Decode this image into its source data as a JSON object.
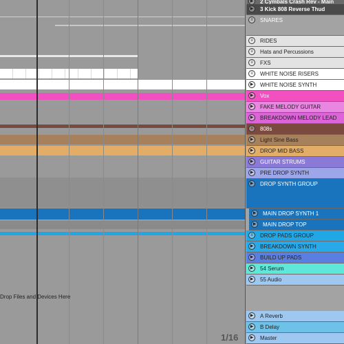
{
  "arrangement": {
    "drop_hint": "Drop Files and Devices Here",
    "zoom_label": "1/16"
  },
  "tracks": [
    {
      "label": "2 Cymbals Crash Rev - Main",
      "icon": "play-icon",
      "color": "#6a6a6a",
      "text_color": "#ffffff",
      "bold": true
    },
    {
      "label": "3 Kick 808 Reverse Thud",
      "icon": "play-icon",
      "color": "#4a4a4a",
      "text_color": "#ffffff",
      "bold": true
    },
    {
      "label": "SNARES",
      "icon": "group-icon",
      "color": "#a3a3a3",
      "text_color": "#ffffff",
      "bold": false
    },
    {
      "label": "RIDES",
      "icon": "group-icon",
      "color": "#e3e3e3",
      "text_color": "#222222",
      "bold": false
    },
    {
      "label": "Hats and Percussions",
      "icon": "group-icon",
      "color": "#e3e3e3",
      "text_color": "#222222",
      "bold": false
    },
    {
      "label": "FXS",
      "icon": "group-icon",
      "color": "#e3e3e3",
      "text_color": "#222222",
      "bold": false
    },
    {
      "label": "WHITE NOISE RISERS",
      "icon": "group-icon",
      "color": "#ffffff",
      "text_color": "#222222",
      "bold": false
    },
    {
      "label": "WHITE NOISE SYNTH",
      "icon": "play-icon",
      "color": "#ffffff",
      "text_color": "#222222",
      "bold": false
    },
    {
      "label": "Vox",
      "icon": "play-icon",
      "color": "#f24fc0",
      "text_color": "#ffffff",
      "bold": false
    },
    {
      "label": "FAKE MELODY GUITAR",
      "icon": "play-icon",
      "color": "#e986e1",
      "text_color": "#222222",
      "bold": false
    },
    {
      "label": "BREAKDOWN MELODY LEAD",
      "icon": "play-icon",
      "color": "#dc63d8",
      "text_color": "#222222",
      "bold": false
    },
    {
      "label": "808s",
      "icon": "group-icon",
      "color": "#7a4a3e",
      "text_color": "#ffffff",
      "bold": false
    },
    {
      "label": "Light Sine Bass",
      "icon": "play-icon",
      "color": "#a7815c",
      "text_color": "#222222",
      "bold": false
    },
    {
      "label": "DROP MID BASS",
      "icon": "play-icon",
      "color": "#e2ad66",
      "text_color": "#222222",
      "bold": false
    },
    {
      "label": "GUITAR STRUMS",
      "icon": "play-icon",
      "color": "#8b79d8",
      "text_color": "#ffffff",
      "bold": false
    },
    {
      "label": "PRE DROP SYNTH",
      "icon": "play-icon",
      "color": "#9ea6ea",
      "text_color": "#222222",
      "bold": false
    },
    {
      "label": "DROP SYNTH GROUP",
      "icon": "play-icon",
      "color": "#1a74bd",
      "text_color": "#ffffff",
      "bold": false
    },
    {
      "label": "MAIN DROP SYNTH 1",
      "icon": "play-icon",
      "color": "#1a74bd",
      "text_color": "#ffffff",
      "bold": false
    },
    {
      "label": "MAIN DROP TOP",
      "icon": "play-icon",
      "color": "#1a74bd",
      "text_color": "#ffffff",
      "bold": false
    },
    {
      "label": "DROP PADS GROUP",
      "icon": "group-icon",
      "color": "#22a7e6",
      "text_color": "#222222",
      "bold": false
    },
    {
      "label": "BREAKDOWN SYNTH",
      "icon": "play-icon",
      "color": "#28a9e9",
      "text_color": "#222222",
      "bold": false
    },
    {
      "label": "BUILD UP PADS",
      "icon": "play-icon",
      "color": "#5b7fe0",
      "text_color": "#222222",
      "bold": false
    },
    {
      "label": "54 Serum",
      "icon": "play-icon",
      "color": "#5fe7d9",
      "text_color": "#222222",
      "bold": false
    },
    {
      "label": "55 Audio",
      "icon": "play-icon",
      "color": "#9fc8f0",
      "text_color": "#222222",
      "bold": false
    },
    {
      "label": "A Reverb",
      "icon": "play-icon",
      "color": "#9fc8f0",
      "text_color": "#222222",
      "bold": false
    },
    {
      "label": "B Delay",
      "icon": "play-icon",
      "color": "#6ec2ea",
      "text_color": "#222222",
      "bold": false
    },
    {
      "label": "Master",
      "icon": "play-icon",
      "color": "#9fc8f0",
      "text_color": "#222222",
      "bold": false
    }
  ]
}
